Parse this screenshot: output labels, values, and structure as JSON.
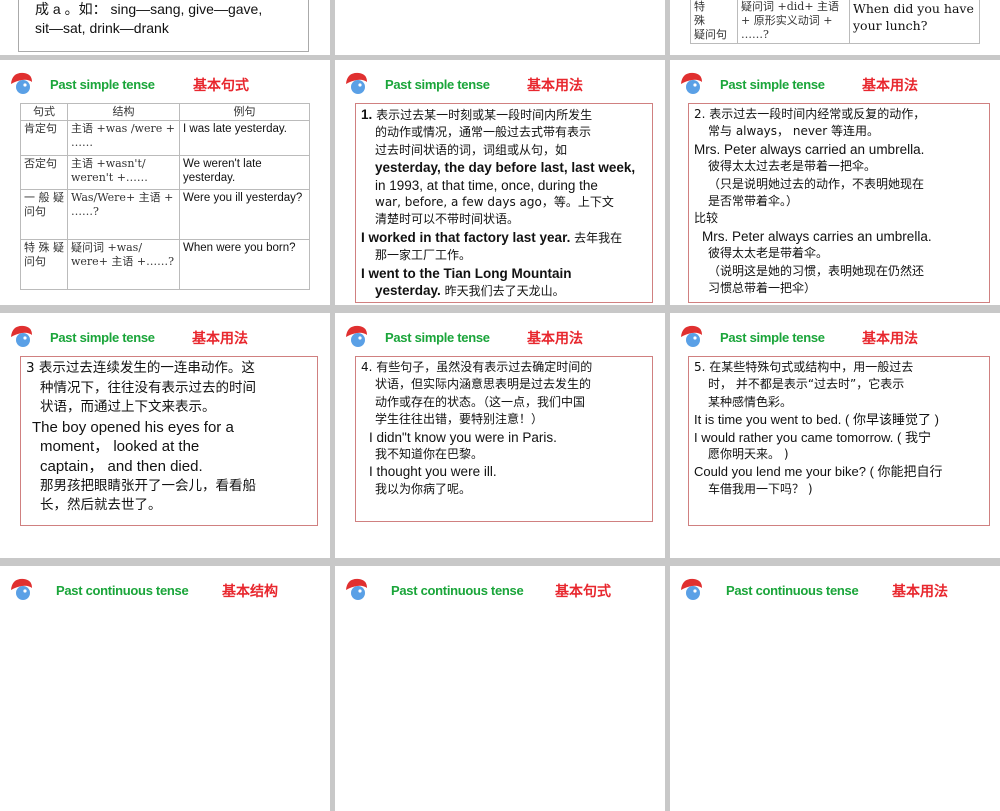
{
  "row0": {
    "left_text": [
      "成 a 。如： sing—sang, give—gave,",
      "sit—sat, drink—drank"
    ],
    "right_table": {
      "label": [
        "特",
        "殊",
        "疑问句"
      ],
      "structure": "疑问词 +did+ 主语 + 原形实义动词 + ……?",
      "example": "When did you have your lunch?"
    }
  },
  "titles": {
    "past_simple": "Past simple tense",
    "past_continuous": "Past continuous tense",
    "basic_sentence": "基本句式",
    "basic_usage": "基本用法",
    "basic_structure": "基本结构"
  },
  "sentence_table": {
    "headers": [
      "句式",
      "结构",
      "例句"
    ],
    "rows": [
      {
        "type": "肯定句",
        "structure": "主语 +was /were + ……",
        "example": "I was late yesterday."
      },
      {
        "type": "否定句",
        "structure": "主语 +wasn't/ weren't +……",
        "example": "We weren't late yesterday."
      },
      {
        "type": "一 般 疑问句",
        "structure": "Was/Were+ 主语 + ……?",
        "example": "Were you ill yesterday?"
      },
      {
        "type": "特 殊 疑问句",
        "structure": "疑问词 +was/ were+ 主语 +……?",
        "example": "When were you born?"
      }
    ]
  },
  "usage1": {
    "num": "1.",
    "l1": "表示过去某一时刻或某一段时间内所发生",
    "l2": "的动作或情况，通常一般过去式带有表示",
    "l3": "过去时间状语的词，词组或从句，如",
    "l4": "yesterday, the day before last, last week,",
    "l5": "in 1993, at that time, once, during the",
    "l6": "war, before, a few days ago，等。上下文",
    "l7": "清楚时可以不带时间状语。",
    "ex1_en": "I worked in that factory last year.",
    "ex1_cn": "去年我在",
    "ex1_cn2": "那一家工厂工作。",
    "ex2_en": "I went to the Tian Long Mountain",
    "ex2_en2": "yesterday.",
    "ex2_cn": "昨天我们去了天龙山。"
  },
  "usage2": {
    "l1": "2. 表示过去一段时间内经常或反复的动作，",
    "l2": "常与 always， never 等连用。",
    "l3": "Mrs. Peter always carried an umbrella.",
    "l4": "彼得太太过去老是带着一把伞。",
    "l5": "（只是说明她过去的动作，不表明她现在",
    "l6": "是否常带着伞。）",
    "l7": "比较",
    "l8": "Mrs. Peter always carries an umbrella.",
    "l9": "彼得太太老是带着伞。",
    "l10": "（说明这是她的习惯，表明她现在仍然还",
    "l11": "习惯总带着一把伞）"
  },
  "usage3": {
    "l1": "3  表示过去连续发生的一连串动作。这",
    "l2": "种情况下，往往没有表示过去的时间",
    "l3": "状语，而通过上下文来表示。",
    "l4": "The boy opened his eyes for a",
    "l5": "moment， looked at the",
    "l6": "captain， and then died.",
    "l7": "那男孩把眼睛张开了一会儿，看看船",
    "l8": "长，然后就去世了。"
  },
  "usage4": {
    "l1": "4. 有些句子，虽然没有表示过去确定时间的",
    "l2": "状语，但实际内涵意思表明是过去发生的",
    "l3": "动作或存在的状态。（这一点，我们中国",
    "l4": "学生往往出错，要特别注意！）",
    "l5": "I didn\"t know you were in Paris.",
    "l6": "我不知道你在巴黎。",
    "l7": "I thought you were ill.",
    "l8": "我以为你病了呢。"
  },
  "usage5": {
    "l1": "5.  在某些特殊句式或结构中，用一般过去",
    "l2": "时， 并不都是表示“过去时”，它表示",
    "l3": "某种感情色彩。",
    "l4": "It is time you went to bed. ( 你早该睡觉了 )",
    "l5": "I would rather you came tomorrow. ( 我宁",
    "l6": "愿你明天来。 )",
    "l7": "Could you lend me your bike? ( 你能把自行",
    "l8": "车借我用一下吗？ )"
  },
  "colors": {
    "title_en": "#1aa53a",
    "title_cn": "#e8272e",
    "box_border": "#d08080"
  }
}
